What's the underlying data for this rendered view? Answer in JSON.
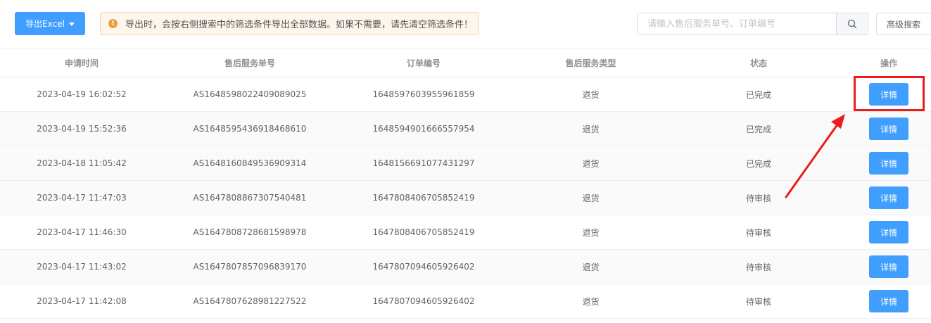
{
  "toolbar": {
    "export_label": "导出Excel",
    "alert_text": "导出时，会按右侧搜索中的筛选条件导出全部数据。如果不需要，请先清空筛选条件！",
    "search_placeholder": "请输入售后服务单号、订单编号",
    "search_value": "",
    "advanced_search_label": "高级搜索"
  },
  "table": {
    "headers": [
      "申请时间",
      "售后服务单号",
      "订单编号",
      "售后服务类型",
      "状态",
      "操作"
    ],
    "rows": [
      {
        "time": "2023-04-19 16:02:52",
        "service_no": "AS1648598022409089025",
        "order_no": "1648597603955961859",
        "type": "退货",
        "status": "已完成",
        "action": "详情"
      },
      {
        "time": "2023-04-19 15:52:36",
        "service_no": "AS1648595436918468610",
        "order_no": "1648594901666557954",
        "type": "退货",
        "status": "已完成",
        "action": "详情"
      },
      {
        "time": "2023-04-18 11:05:42",
        "service_no": "AS1648160849536909314",
        "order_no": "1648156691077431297",
        "type": "退货",
        "status": "已完成",
        "action": "详情"
      },
      {
        "time": "2023-04-17 11:47:03",
        "service_no": "AS1647808867307540481",
        "order_no": "1647808406705852419",
        "type": "退货",
        "status": "待审核",
        "action": "详情"
      },
      {
        "time": "2023-04-17 11:46:30",
        "service_no": "AS1647808728681598978",
        "order_no": "1647808406705852419",
        "type": "退货",
        "status": "待审核",
        "action": "详情"
      },
      {
        "time": "2023-04-17 11:43:02",
        "service_no": "AS1647807857096839170",
        "order_no": "1647807094605926402",
        "type": "退货",
        "status": "待审核",
        "action": "详情"
      },
      {
        "time": "2023-04-17 11:42:08",
        "service_no": "AS1647807628981227522",
        "order_no": "1647807094605926402",
        "type": "退货",
        "status": "待审核",
        "action": "详情"
      }
    ]
  },
  "icons": {
    "export_dropdown": "caret-down-icon",
    "alert": "warning-icon",
    "search": "search-icon"
  },
  "colors": {
    "primary": "#409eff",
    "warning": "#e6a23c",
    "annotation": "#ee1b1b"
  }
}
